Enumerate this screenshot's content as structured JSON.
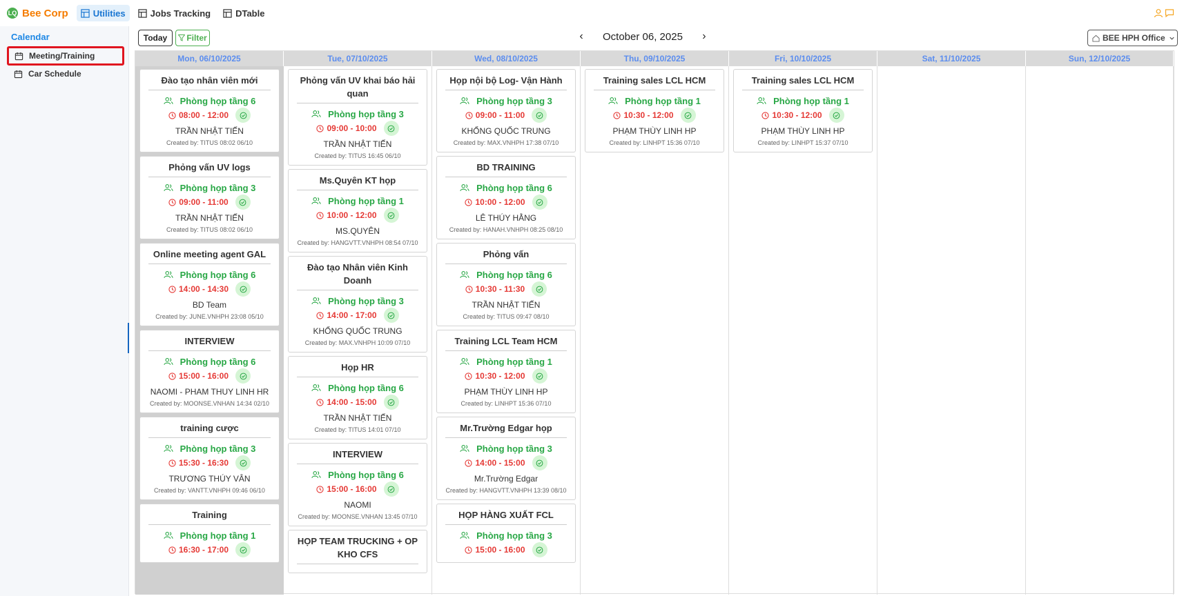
{
  "app": {
    "brand": "Bee Corp",
    "brand_logo_text": "LQ"
  },
  "topnav": [
    {
      "label": "Utilities",
      "active": true
    },
    {
      "label": "Jobs Tracking",
      "active": false
    },
    {
      "label": "DTable",
      "active": false
    }
  ],
  "sidebar": {
    "title": "Calendar",
    "items": [
      {
        "label": "Meeting/Training",
        "highlighted": true
      },
      {
        "label": "Car Schedule",
        "highlighted": false
      }
    ]
  },
  "toolbar": {
    "today_label": "Today",
    "filter_label": "Filter",
    "prev_label": "‹",
    "next_label": "›",
    "current_date": "October 06, 2025",
    "office": "BEE HPH Office"
  },
  "days": [
    {
      "header": "Mon, 06/10/2025",
      "today": true,
      "events": [
        {
          "title": "Đào tạo nhân viên mới",
          "room": "Phòng họp tầng 6",
          "time": "08:00 - 12:00",
          "person": "TRẦN NHẬT TIẾN",
          "created": "Created by: TITUS 08:02 06/10"
        },
        {
          "title": "Phỏng vấn UV logs",
          "room": "Phòng họp tầng 3",
          "time": "09:00 - 11:00",
          "person": "TRẦN NHẬT TIẾN",
          "created": "Created by: TITUS 08:02 06/10"
        },
        {
          "title": "Online meeting agent GAL",
          "room": "Phòng họp tầng 6",
          "time": "14:00 - 14:30",
          "person": "BD Team",
          "created": "Created by: JUNE.VNHPH 23:08 05/10"
        },
        {
          "title": "INTERVIEW",
          "room": "Phòng họp tầng 6",
          "time": "15:00 - 16:00",
          "person": "NAOMI - PHAM THUY LINH HR",
          "created": "Created by: MOONSE.VNHAN 14:34 02/10"
        },
        {
          "title": "training cược",
          "room": "Phòng họp tầng 3",
          "time": "15:30 - 16:30",
          "person": "TRƯƠNG THÚY VÂN",
          "created": "Created by: VANTT.VNHPH 09:46 06/10"
        },
        {
          "title": "Training",
          "room": "Phòng họp tầng 1",
          "time": "16:30 - 17:00",
          "person": "",
          "created": ""
        }
      ]
    },
    {
      "header": "Tue, 07/10/2025",
      "today": false,
      "events": [
        {
          "title": "Phỏng vấn UV khai báo hải quan",
          "room": "Phòng họp tầng 3",
          "time": "09:00 - 10:00",
          "person": "TRẦN NHẬT TIẾN",
          "created": "Created by: TITUS 16:45 06/10"
        },
        {
          "title": "Ms.Quyên KT họp",
          "room": "Phòng họp tầng 1",
          "time": "10:00 - 12:00",
          "person": "MS.QUYÊN",
          "created": "Created by: HANGVTT.VNHPH 08:54 07/10"
        },
        {
          "title": "Đào tạo Nhân viên Kinh Doanh",
          "room": "Phòng họp tầng 3",
          "time": "14:00 - 17:00",
          "person": "KHỔNG QUỐC TRUNG",
          "created": "Created by: MAX.VNHPH 10:09 07/10"
        },
        {
          "title": "Họp HR",
          "room": "Phòng họp tầng 6",
          "time": "14:00 - 15:00",
          "person": "TRẦN NHẬT TIẾN",
          "created": "Created by: TITUS 14:01 07/10"
        },
        {
          "title": "INTERVIEW",
          "room": "Phòng họp tầng 6",
          "time": "15:00 - 16:00",
          "person": "NAOMI",
          "created": "Created by: MOONSE.VNHAN 13:45 07/10"
        },
        {
          "title": "HỌP TEAM TRUCKING + OP KHO CFS",
          "room": "",
          "time": "",
          "person": "",
          "created": ""
        }
      ]
    },
    {
      "header": "Wed, 08/10/2025",
      "today": false,
      "events": [
        {
          "title": "Họp nội bộ Log- Vận Hành",
          "room": "Phòng họp tầng 3",
          "time": "09:00 - 11:00",
          "person": "KHỔNG QUỐC TRUNG",
          "created": "Created by: MAX.VNHPH 17:38 07/10"
        },
        {
          "title": "BD TRAINING",
          "room": "Phòng họp tầng 6",
          "time": "10:00 - 12:00",
          "person": "LÊ THÚY HẰNG",
          "created": "Created by: HANAH.VNHPH 08:25 08/10"
        },
        {
          "title": "Phỏng vấn",
          "room": "Phòng họp tầng 6",
          "time": "10:30 - 11:30",
          "person": "TRẦN NHẬT TIẾN",
          "created": "Created by: TITUS 09:47 08/10"
        },
        {
          "title": "Training LCL Team HCM",
          "room": "Phòng họp tầng 1",
          "time": "10:30 - 12:00",
          "person": "PHẠM THÙY LINH HP",
          "created": "Created by: LINHPT 15:36 07/10"
        },
        {
          "title": "Mr.Trường Edgar họp",
          "room": "Phòng họp tầng 3",
          "time": "14:00 - 15:00",
          "person": "Mr.Trường Edgar",
          "created": "Created by: HANGVTT.VNHPH 13:39 08/10"
        },
        {
          "title": "HỌP HÀNG XUẤT FCL",
          "room": "Phòng họp tầng 3",
          "time": "15:00 - 16:00",
          "person": "",
          "created": ""
        }
      ]
    },
    {
      "header": "Thu, 09/10/2025",
      "today": false,
      "events": [
        {
          "title": "Training sales LCL HCM",
          "room": "Phòng họp tầng 1",
          "time": "10:30 - 12:00",
          "person": "PHẠM THÙY LINH HP",
          "created": "Created by: LINHPT 15:36 07/10"
        }
      ]
    },
    {
      "header": "Fri, 10/10/2025",
      "today": false,
      "events": [
        {
          "title": "Training sales LCL HCM",
          "room": "Phòng họp tầng 1",
          "time": "10:30 - 12:00",
          "person": "PHẠM THÙY LINH HP",
          "created": "Created by: LINHPT 15:37 07/10"
        }
      ]
    },
    {
      "header": "Sat, 11/10/2025",
      "today": false,
      "events": []
    },
    {
      "header": "Sun, 12/10/2025",
      "today": false,
      "events": []
    }
  ]
}
